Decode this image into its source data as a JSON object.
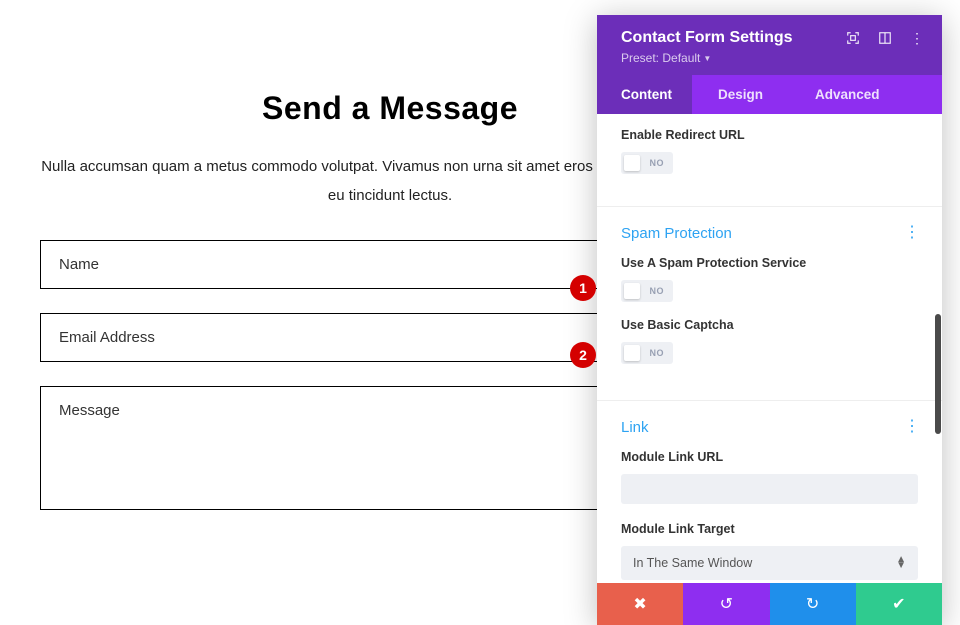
{
  "page": {
    "title": "Send a Message",
    "description": "Nulla accumsan quam a metus commodo volutpat. Vivamus non urna sit amet eros pharetra luctus. Nulla eu tincidunt lectus.",
    "fields": {
      "name_placeholder": "Name",
      "email_placeholder": "Email Address",
      "message_placeholder": "Message"
    }
  },
  "panel": {
    "title": "Contact Form Settings",
    "preset_label": "Preset: Default",
    "tabs": {
      "content": "Content",
      "design": "Design",
      "advanced": "Advanced"
    },
    "redirect": {
      "enable_label": "Enable Redirect URL",
      "value": "NO"
    },
    "spam": {
      "section_title": "Spam Protection",
      "service_label": "Use A Spam Protection Service",
      "service_value": "NO",
      "captcha_label": "Use Basic Captcha",
      "captcha_value": "NO"
    },
    "link": {
      "section_title": "Link",
      "url_label": "Module Link URL",
      "url_value": "",
      "target_label": "Module Link Target",
      "target_value": "In The Same Window"
    }
  },
  "annotations": {
    "b1": "1",
    "b2": "2"
  }
}
